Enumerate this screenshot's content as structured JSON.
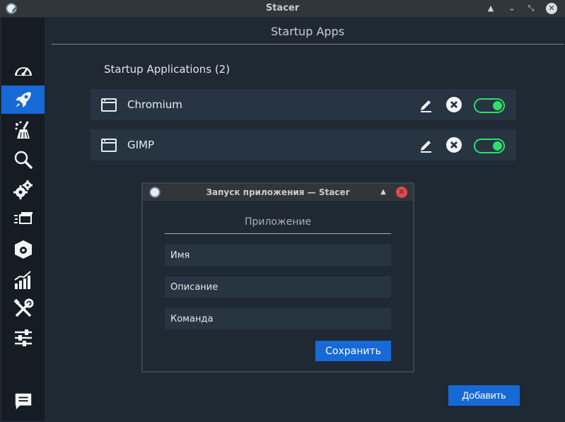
{
  "window": {
    "title": "Stacer"
  },
  "header": {
    "title": "Startup Apps"
  },
  "section": {
    "title": "Startup Applications (2)"
  },
  "apps": [
    {
      "name": "Chromium",
      "enabled": true
    },
    {
      "name": "GIMP",
      "enabled": true
    }
  ],
  "add_button": {
    "label": "Добавить"
  },
  "dialog": {
    "title": "Запуск приложения — Stacer",
    "subtitle": "Приложение",
    "name_placeholder": "Имя",
    "description_placeholder": "Описание",
    "command_placeholder": "Команда",
    "save_label": "Сохранить"
  },
  "sidebar": {
    "items": [
      {
        "icon": "dashboard-icon"
      },
      {
        "icon": "rocket-icon",
        "active": true
      },
      {
        "icon": "broom-icon"
      },
      {
        "icon": "search-icon"
      },
      {
        "icon": "gears-icon"
      },
      {
        "icon": "services-icon"
      },
      {
        "icon": "uninstaller-icon"
      },
      {
        "icon": "resources-chart-icon"
      },
      {
        "icon": "tools-icon"
      },
      {
        "icon": "settings-sliders-icon"
      }
    ],
    "footer_icon": "feedback-icon"
  },
  "colors": {
    "accent": "#1769d6",
    "toggle_on": "#2ee06a",
    "close_red": "#e5484d"
  }
}
